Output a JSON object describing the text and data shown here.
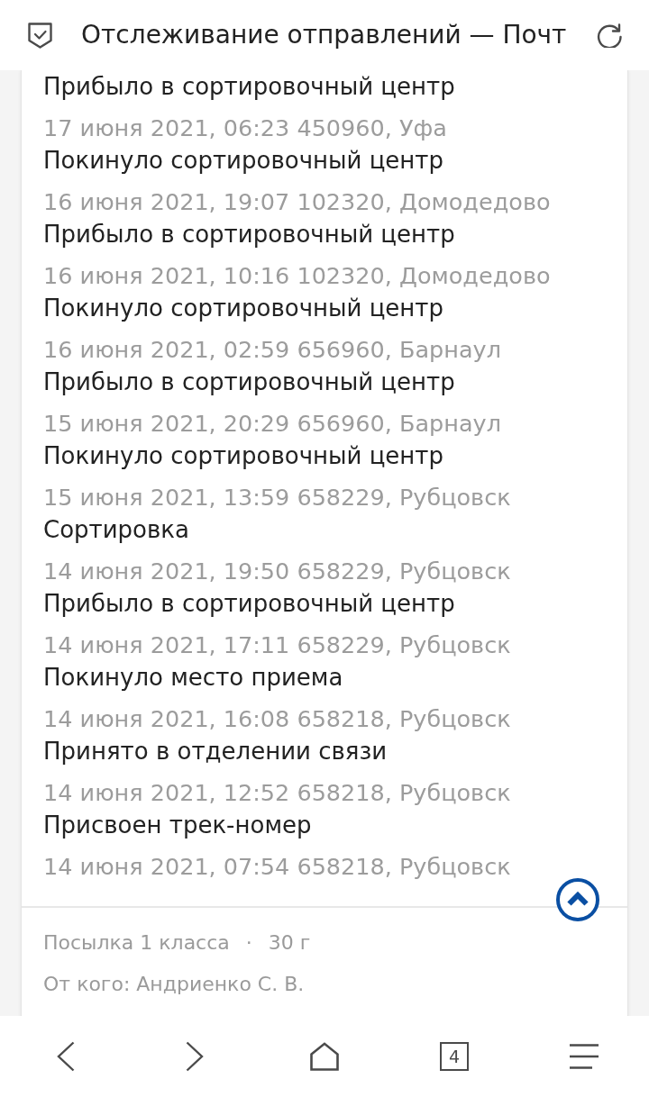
{
  "header": {
    "title": "Отслеживание отправлений — Почт"
  },
  "events": [
    {
      "status": "Прибыло в сортировочный центр",
      "details": "17 июня 2021, 06:23 450960, Уфа"
    },
    {
      "status": "Покинуло сортировочный центр",
      "details": "16 июня 2021, 19:07 102320, Домодедово"
    },
    {
      "status": "Прибыло в сортировочный центр",
      "details": "16 июня 2021, 10:16 102320, Домодедово"
    },
    {
      "status": "Покинуло сортировочный центр",
      "details": "16 июня 2021, 02:59 656960, Барнаул"
    },
    {
      "status": "Прибыло в сортировочный центр",
      "details": "15 июня 2021, 20:29 656960, Барнаул"
    },
    {
      "status": "Покинуло сортировочный центр",
      "details": "15 июня 2021, 13:59 658229, Рубцовск"
    },
    {
      "status": "Сортировка",
      "details": "14 июня 2021, 19:50 658229, Рубцовск"
    },
    {
      "status": "Прибыло в сортировочный центр",
      "details": "14 июня 2021, 17:11 658229, Рубцовск"
    },
    {
      "status": "Покинуло место приема",
      "details": "14 июня 2021, 16:08 658218, Рубцовск"
    },
    {
      "status": "Принято в отделении связи",
      "details": "14 июня 2021, 12:52 658218, Рубцовск"
    },
    {
      "status": "Присвоен трек-номер",
      "details": "14 июня 2021, 07:54 658218, Рубцовск"
    }
  ],
  "parcel": {
    "type": "Посылка 1 класса",
    "separator": "·",
    "weight": "30 г",
    "sender": "От кого: Андриенко С. В."
  },
  "bottom_bar": {
    "tab_count": "4"
  }
}
